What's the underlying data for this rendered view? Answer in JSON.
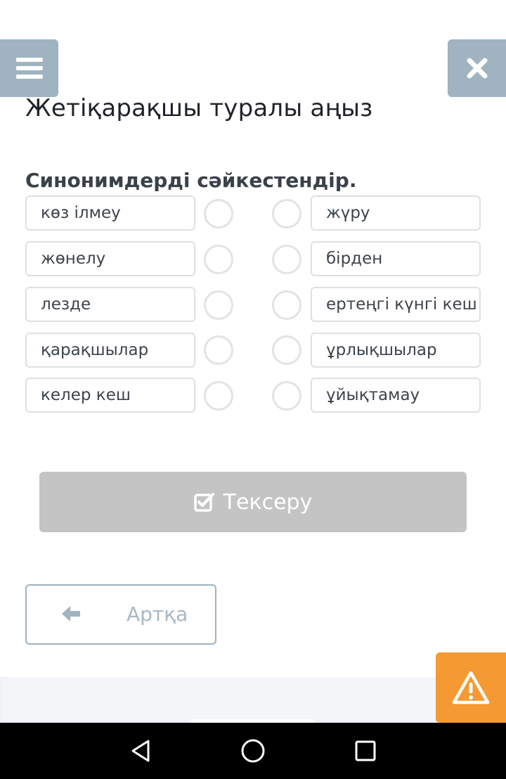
{
  "header": {
    "menu_icon": "hamburger-menu-icon",
    "close_icon": "close-icon"
  },
  "page": {
    "title": "Жетіқарақшы туралы аңыз",
    "instruction": "Синонимдерді сәйкестендір."
  },
  "left_items": [
    "көз ілмеу",
    "жөнелу",
    "лезде",
    "қарақшылар",
    "келер кеш"
  ],
  "right_items": [
    "жүру",
    "бірден",
    "ертеңгі күнгі кеш",
    "ұрлықшылар",
    "ұйықтамау"
  ],
  "actions": {
    "check_label": "Тексеру",
    "check_icon": "checkbox-check-icon",
    "back_label": "Артқа",
    "back_icon": "arrow-left-icon",
    "warning_icon": "warning-triangle-icon"
  },
  "colors": {
    "header_button": "#9fb3c0",
    "check_button_disabled": "#c4c4c4",
    "warning": "#f59a32"
  },
  "system_nav": {
    "back_icon": "nav-back-triangle-icon",
    "home_icon": "nav-home-circle-icon",
    "recents_icon": "nav-recents-square-icon"
  }
}
